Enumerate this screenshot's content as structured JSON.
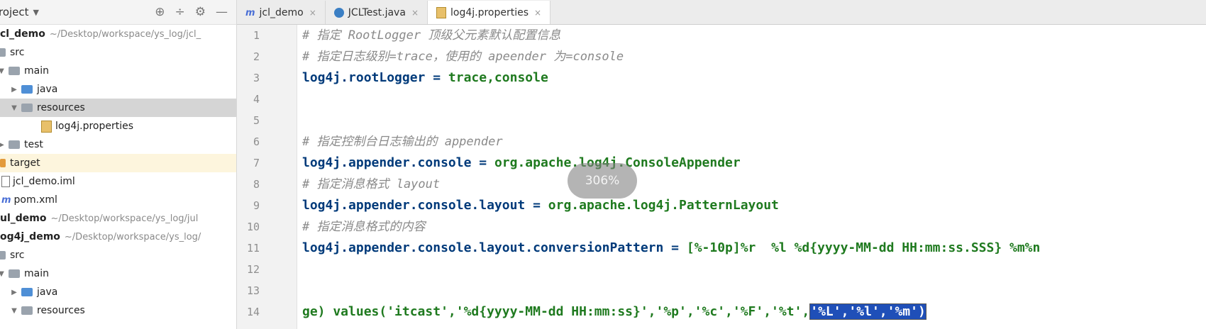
{
  "project_panel": {
    "title": "roject",
    "rows": [
      {
        "label": "cl_demo",
        "path": "~/Desktop/workspace/ys_log/jcl_",
        "bold": true
      },
      {
        "label": "src"
      },
      {
        "label": "main"
      },
      {
        "label": "java"
      },
      {
        "label": "resources"
      },
      {
        "label": "log4j.properties"
      },
      {
        "label": "test"
      },
      {
        "label": "target"
      },
      {
        "label": "jcl_demo.iml"
      },
      {
        "label": "pom.xml"
      },
      {
        "label": "ul_demo",
        "path": "~/Desktop/workspace/ys_log/jul",
        "bold": true
      },
      {
        "label": "og4j_demo",
        "path": "~/Desktop/workspace/ys_log/",
        "bold": true
      },
      {
        "label": "src"
      },
      {
        "label": "main"
      },
      {
        "label": "java"
      },
      {
        "label": "resources"
      }
    ]
  },
  "tabs": [
    {
      "label": "jcl_demo"
    },
    {
      "label": "JCLTest.java"
    },
    {
      "label": "log4j.properties"
    }
  ],
  "editor": {
    "line_numbers": [
      "1",
      "2",
      "3",
      "4",
      "5",
      "6",
      "7",
      "8",
      "9",
      "10",
      "11",
      "12",
      "13",
      "14"
    ],
    "lines": {
      "l1": "# 指定 RootLogger 顶级父元素默认配置信息",
      "l2": "# 指定日志级别=trace，使用的 apeender 为=console",
      "l3_key": "log4j.rootLogger = ",
      "l3_val": "trace,console",
      "l6": "# 指定控制台日志输出的 appender",
      "l7_key": "log4j.appender.console = ",
      "l7_val": "org.apache.log4j.ConsoleAppender",
      "l8": "# 指定消息格式 layout",
      "l9_key": "log4j.appender.console.layout = ",
      "l9_val": "org.apache.log4j.PatternLayout",
      "l10": "# 指定消息格式的内容",
      "l11_key": "log4j.appender.console.layout.conversionPattern = ",
      "l11_val": "[%-10p]%r  %l %d{yyyy-MM-dd HH:mm:ss.SSS} %m%n",
      "l14_a": "ge) values('itcast','%d{yyyy-MM-dd HH:mm:ss}','%p','%c','%F','%t',",
      "l14_sel": "'%L','%l','%m')"
    }
  },
  "zoom_overlay": "306%"
}
